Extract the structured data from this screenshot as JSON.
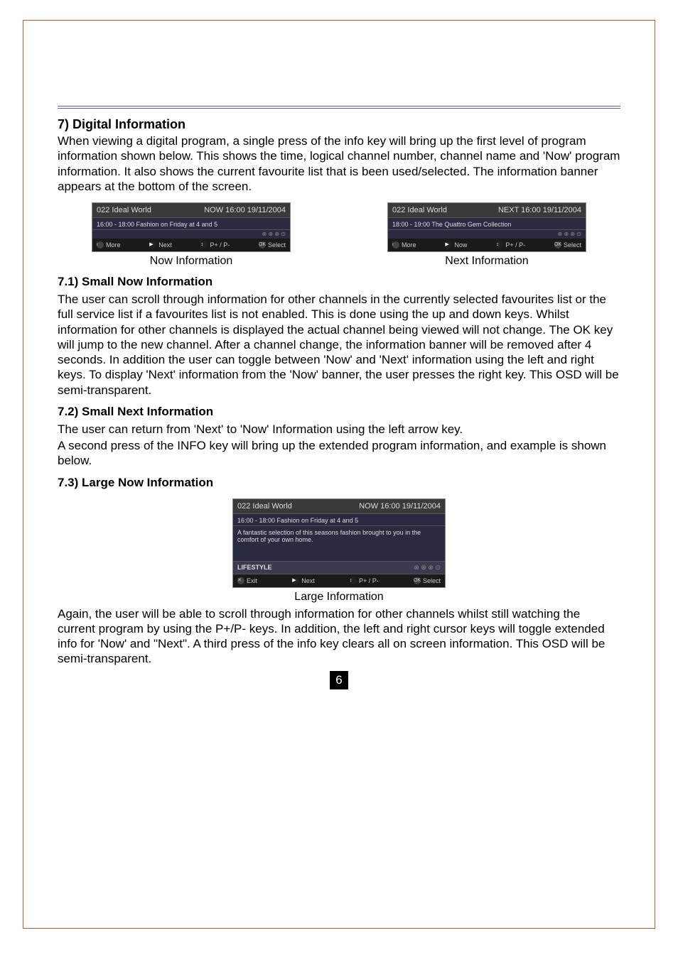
{
  "section7": {
    "title": "7) Digital Information",
    "intro": "When viewing a digital program, a single press of the info key will bring up the first level of program information shown below. This shows the time, logical channel number, channel name and 'Now' program information. It also shows the current favourite list that is been used/selected. The information banner appears at the bottom of the screen."
  },
  "osd_now": {
    "channel": "022 Ideal World",
    "headright": "NOW 16:00 19/11/2004",
    "program": "16:00 - 18:00  Fashion on Friday at 4 and 5",
    "more": "More",
    "next": "Next",
    "pkeys": "P+ / P-",
    "select": "Select",
    "caption": "Now Information"
  },
  "osd_next": {
    "channel": "022 Ideal World",
    "headright": "NEXT 16:00 19/11/2004",
    "program": "18:00 - 19:00  The Quattro Gem Collection",
    "more": "More",
    "now": "Now",
    "pkeys": "P+ / P-",
    "select": "Select",
    "caption": "Next Information"
  },
  "section71": {
    "title": "7.1) Small Now Information",
    "body": "The user can scroll through information for other channels in the currently selected favourites list or the full service list if a favourites list is not enabled. This is done using the up and down keys. Whilst information for other channels is displayed the actual channel being viewed will not change. The OK key will jump to the new channel. After a channel change, the information banner will be removed after 4 seconds. In addition the user can toggle between 'Now' and 'Next' information using the left and right keys. To display 'Next' information from the 'Now' banner, the user presses the right key. This OSD will be semi-transparent."
  },
  "section72": {
    "title": "7.2) Small Next Information",
    "body1": "The user can return from 'Next' to 'Now' Information using the left arrow key.",
    "body2": "A second press of the INFO key will bring up the extended program information, and example is shown below."
  },
  "section73": {
    "title": "7.3) Large Now Information"
  },
  "osd_large": {
    "channel": "022 Ideal World",
    "headright": "NOW 16:00 19/11/2004",
    "program": "16:00 - 18:00  Fashion on Friday at 4 and 5",
    "desc": "A fantastic selection of this seasons fashion brought to you in the comfort of your own home.",
    "lifestyle": "LIFESTYLE",
    "exit": "Exit",
    "next": "Next",
    "pkeys": "P+ / P-",
    "select": "Select",
    "caption": "Large Information"
  },
  "section73_body": "Again, the user will be able to scroll through information for other channels whilst still watching the current program by using the P+/P- keys. In addition, the left and right cursor keys will toggle extended info for 'Now' and \"Next\". A third press of the info key clears all on screen information. This OSD will be semi-transparent.",
  "page_number": "6"
}
